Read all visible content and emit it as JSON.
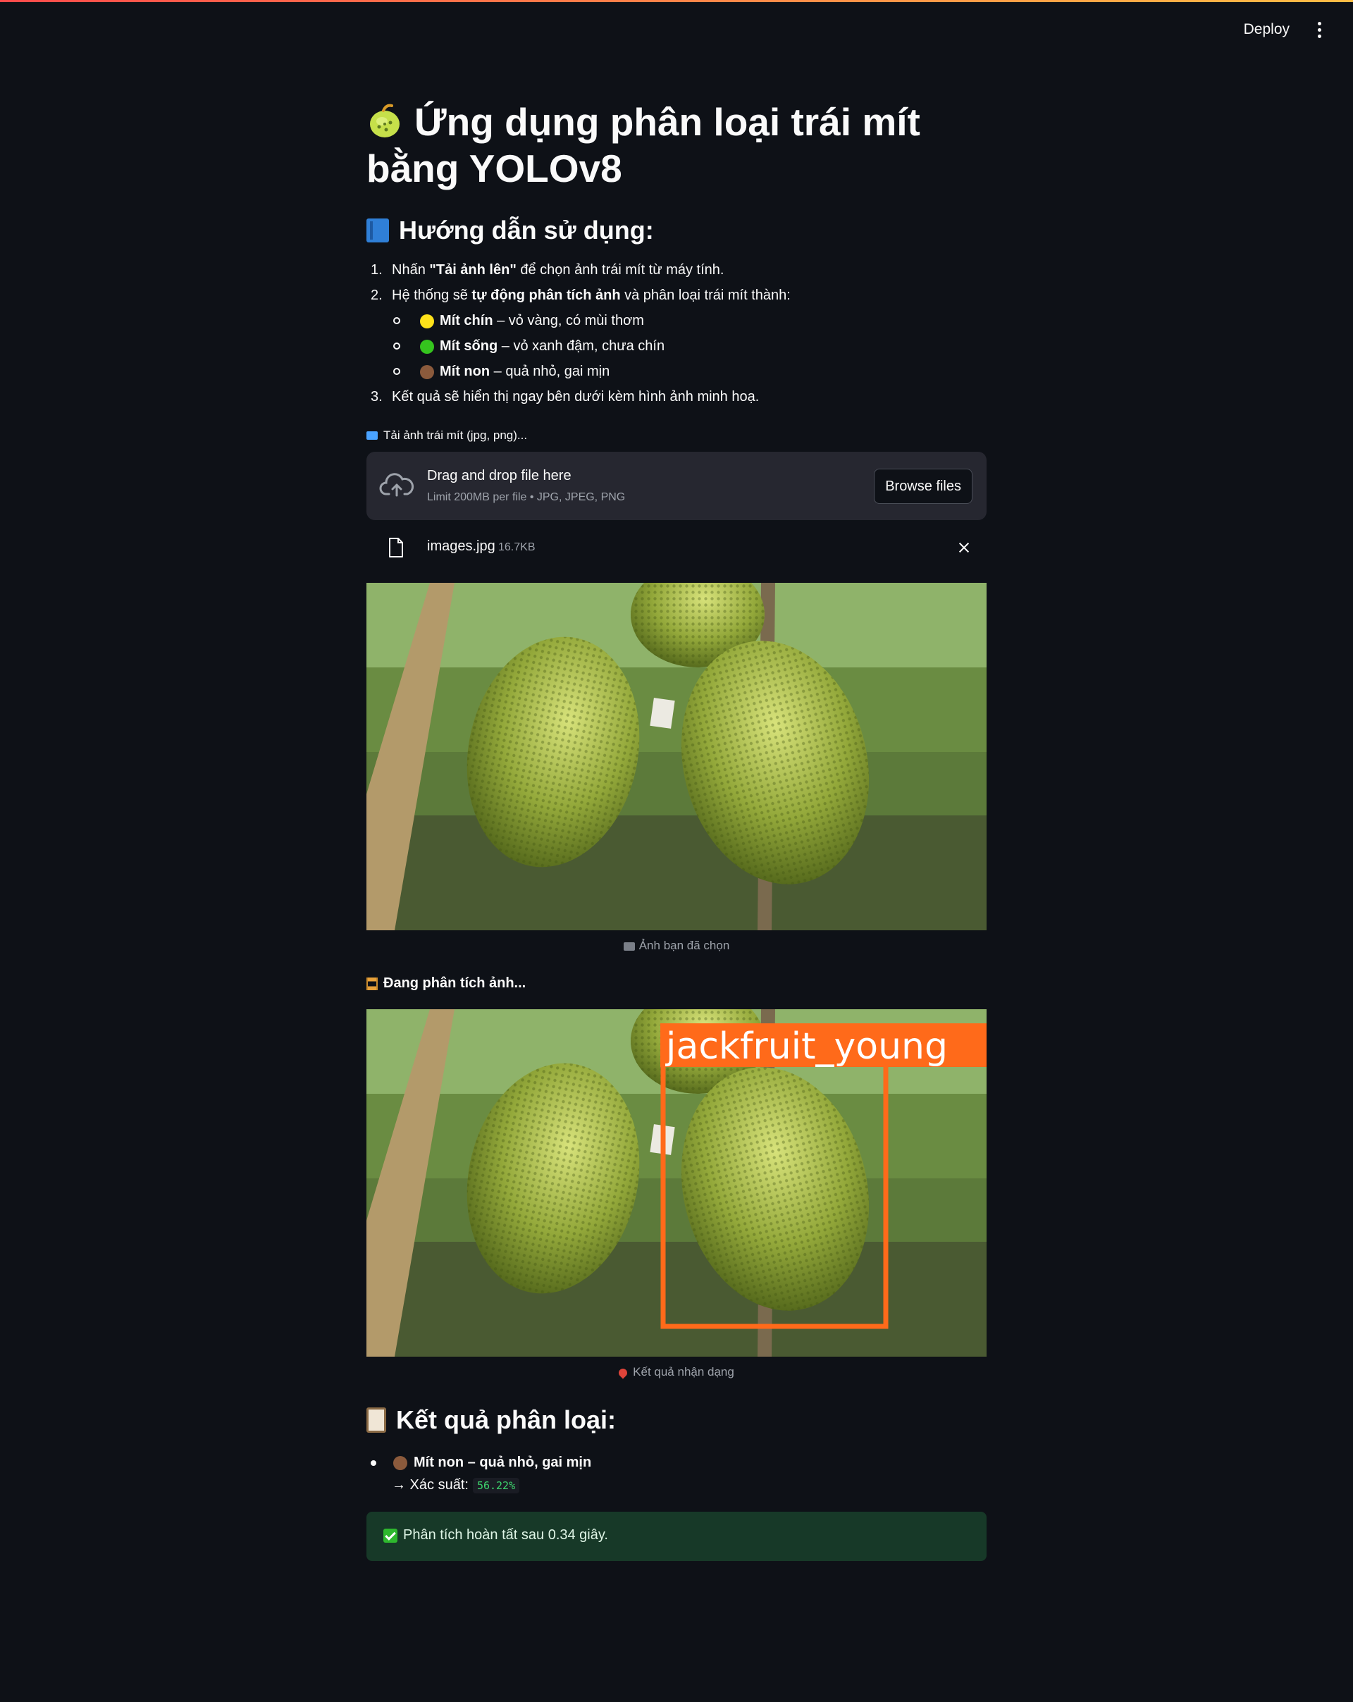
{
  "header": {
    "deploy_label": "Deploy"
  },
  "page": {
    "title": "Ứng dụng phân loại trái mít bằng YOLOv8"
  },
  "guide": {
    "heading": "Hướng dẫn sử dụng:",
    "steps": [
      {
        "num": "1.",
        "pre": "Nhấn ",
        "bold": "\"Tải ảnh lên\"",
        "post": " để chọn ảnh trái mít từ máy tính."
      },
      {
        "num": "2.",
        "pre": "Hệ thống sẽ ",
        "bold": "tự động phân tích ảnh",
        "post": " và phân loại trái mít thành:"
      },
      {
        "num": "3.",
        "text": "Kết quả sẽ hiển thị ngay bên dưới kèm hình ảnh minh hoạ."
      }
    ],
    "classes": [
      {
        "name": "Mít chín",
        "desc": " – vỏ vàng, có mùi thơm",
        "color": "#ffe21a"
      },
      {
        "name": "Mít sống",
        "desc": " – vỏ xanh đậm, chưa chín",
        "color": "#35c41e"
      },
      {
        "name": "Mít non",
        "desc": " – quả nhỏ, gai mịn",
        "color": "#8b5a3c"
      }
    ]
  },
  "uploader": {
    "label": "Tải ảnh trái mít (jpg, png)...",
    "drop_title": "Drag and drop file here",
    "drop_sub": "Limit 200MB per file • JPG, JPEG, PNG",
    "browse_label": "Browse files",
    "file_name": "images.jpg",
    "file_size": "16.7KB"
  },
  "preview": {
    "caption": "Ảnh bạn đã chọn"
  },
  "analysis": {
    "status": "Đang phân tích ảnh...",
    "detection_label": "jackfruit_young",
    "box_color": "#ff6a1a",
    "caption": "Kết quả nhận dạng"
  },
  "result": {
    "heading": "Kết quả phân loại:",
    "item_label": "Mít non – quả nhỏ, gai mịn",
    "item_color": "#8b5a3c",
    "prob_label": "→ Xác suất:",
    "prob_value": "56.22%",
    "success": "Phân tích hoàn tất sau 0.34 giây."
  }
}
